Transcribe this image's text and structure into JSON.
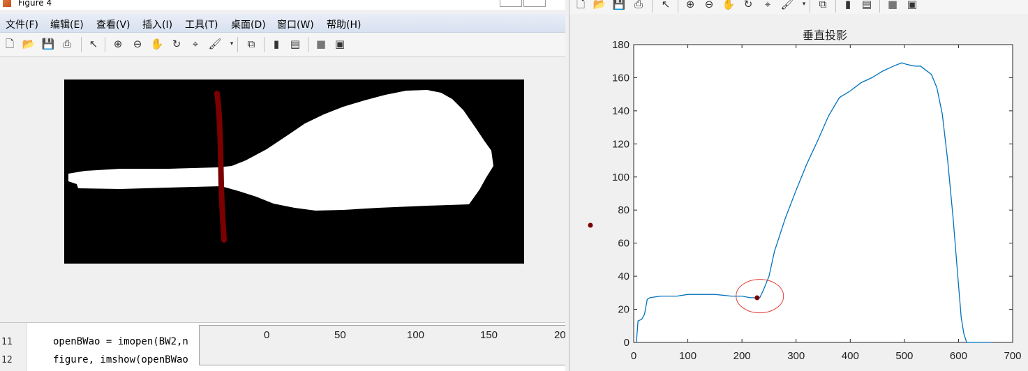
{
  "left_window": {
    "title": "Figure 4",
    "menu": [
      "文件(F)",
      "编辑(E)",
      "查看(V)",
      "插入(I)",
      "工具(T)",
      "桌面(D)",
      "窗口(W)",
      "帮助(H)"
    ],
    "toolbar_icons": [
      "new-file-icon",
      "open-folder-icon",
      "save-icon",
      "print-icon",
      "pointer-icon",
      "zoom-in-icon",
      "zoom-out-icon",
      "pan-hand-icon",
      "rotate-3d-icon",
      "data-cursor-icon",
      "brush-icon",
      "link-plot-icon",
      "colorbar-icon",
      "legend-icon",
      "hide-plot-tools-icon",
      "show-plot-tools-icon"
    ],
    "image": {
      "description_colors": {
        "background": "#000000",
        "shape": "#ffffff",
        "marker_line": "#7b0000"
      }
    }
  },
  "editor": {
    "lines": [
      {
        "number": "11",
        "code": "openBWao = imopen(BW2,n"
      },
      {
        "number": "12",
        "code": "figure, imshow(openBWao"
      }
    ]
  },
  "background_figure": {
    "x_ticks": [
      "0",
      "50",
      "100",
      "150",
      "20"
    ]
  },
  "right_window": {
    "toolbar_icons": [
      "new-file-icon",
      "open-folder-icon",
      "save-icon",
      "print-icon",
      "pointer-icon",
      "zoom-in-icon",
      "zoom-out-icon",
      "pan-hand-icon",
      "rotate-3d-icon",
      "data-cursor-icon",
      "brush-icon",
      "link-plot-icon",
      "colorbar-icon",
      "legend-icon",
      "hide-plot-tools-icon",
      "show-plot-tools-icon"
    ]
  },
  "chart_data": {
    "type": "line",
    "title": "垂直投影",
    "xlabel": "",
    "ylabel": "",
    "xlim": [
      0,
      700
    ],
    "ylim": [
      0,
      180
    ],
    "xticks": [
      0,
      100,
      200,
      300,
      400,
      500,
      600,
      700
    ],
    "yticks": [
      0,
      20,
      40,
      60,
      80,
      100,
      120,
      140,
      160,
      180
    ],
    "grid": false,
    "line_color": "#0072bd",
    "series": [
      {
        "x": [
          5,
          8,
          15,
          20,
          25,
          30,
          50,
          80,
          100,
          120,
          150,
          180,
          200,
          215,
          225,
          233,
          240,
          250,
          260,
          280,
          300,
          320,
          340,
          360,
          380,
          400,
          420,
          440,
          460,
          480,
          495,
          505,
          520,
          530,
          550,
          560,
          570,
          580,
          590,
          600,
          605,
          610,
          615,
          660
        ],
        "y": [
          0,
          13,
          14,
          17,
          26,
          27,
          28,
          28,
          29,
          29,
          29,
          28,
          28,
          27,
          27,
          27,
          32,
          40,
          55,
          75,
          92,
          108,
          122,
          137,
          148,
          152,
          157,
          160,
          164,
          167,
          169,
          168,
          167,
          167,
          162,
          154,
          138,
          110,
          75,
          35,
          15,
          5,
          0,
          0
        ]
      }
    ],
    "annotations": [
      {
        "type": "point",
        "x": 228,
        "y": 27,
        "color": "#7b0000"
      },
      {
        "type": "ellipse",
        "cx": 233,
        "cy": 28,
        "color": "#e0403a"
      }
    ]
  },
  "stray_marker": {
    "color": "#7b0000"
  }
}
